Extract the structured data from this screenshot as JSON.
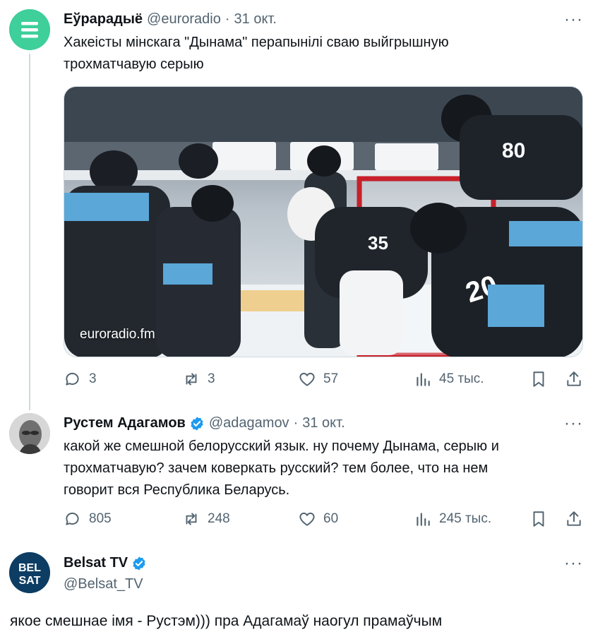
{
  "tweets": [
    {
      "name": "Еўрарадыё",
      "handle": "@euroradio",
      "date": "31 окт.",
      "text_lines": [
        "Хакеісты мінскага \"Дынама\" перапынілі сваю выйгрышную",
        "трохматчавую серыю"
      ],
      "media_watermark": "euroradio.fm",
      "replies": "3",
      "reposts": "3",
      "likes": "57",
      "views": "45 тыс."
    },
    {
      "name": "Рустем Адагамов",
      "handle": "@adagamov",
      "date": "31 окт.",
      "text_lines": [
        "какой же смешной белорусский язык. ну почему Дынама, серыю и",
        "трохматчавую? зачем коверкать русский? тем более, что на нем",
        "говорит вся Республика Беларусь."
      ],
      "replies": "805",
      "reposts": "248",
      "likes": "60",
      "views": "245 тыс."
    },
    {
      "name": "Belsat TV",
      "handle": "@Belsat_TV",
      "avatar_text": [
        "BEL",
        "SAT"
      ],
      "text_lines": [
        "якое смешнае імя - Рустэм))) пра Адагамаў наогул прамаўчым"
      ]
    }
  ],
  "more_glyph": "···",
  "separator": "·",
  "colors": {
    "text": "#0f1419",
    "secondary": "#536471",
    "verified": "#1d9bf0",
    "euroradio_avatar": "#3ecf9a",
    "belsat_avatar": "#0d3d63",
    "thread_line": "#cfd9de"
  },
  "icons": [
    "menu-lines-icon",
    "verified-badge-icon",
    "more-icon",
    "reply-icon",
    "repost-icon",
    "like-icon",
    "views-icon",
    "bookmark-icon",
    "share-icon"
  ]
}
